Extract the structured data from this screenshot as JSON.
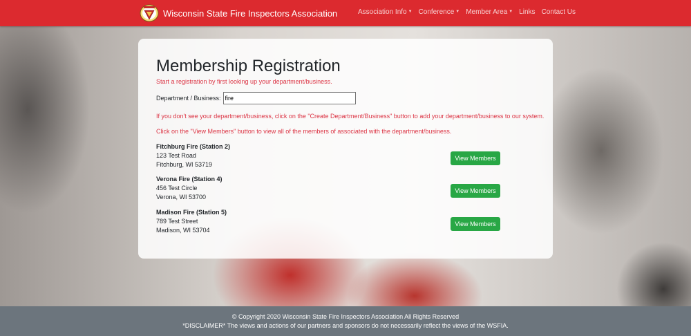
{
  "header": {
    "brand": "Wisconsin State Fire Inspectors Association",
    "nav": [
      {
        "label": "Association Info",
        "dropdown": true
      },
      {
        "label": "Conference",
        "dropdown": true
      },
      {
        "label": "Member Area",
        "dropdown": true
      },
      {
        "label": "Links",
        "dropdown": false
      },
      {
        "label": "Contact Us",
        "dropdown": false
      }
    ]
  },
  "main": {
    "title": "Membership Registration",
    "intro": "Start a registration by first looking up your department/business.",
    "lookup_label": "Department / Business:",
    "lookup_value": "fire",
    "note_create": "If you don't see your department/business, click on the \"Create Department/Business\" button to add your department/business to our system.",
    "note_view": "Click on the \"View Members\" button to view all of the members of associated with the department/business.",
    "departments": [
      {
        "name": "Fitchburg Fire (Station 2)",
        "street": "123 Test Road",
        "city": "Fitchburg, WI 53719",
        "button": "View Members"
      },
      {
        "name": "Verona Fire (Station 4)",
        "street": "456 Test Circle",
        "city": "Verona, WI 53700",
        "button": "View Members"
      },
      {
        "name": "Madison Fire (Station 5)",
        "street": "789 Test Street",
        "city": "Madison, WI 53704",
        "button": "View Members"
      }
    ]
  },
  "footer": {
    "copyright": "© Copyright 2020 Wisconsin State Fire Inspectors Association All Rights Reserved",
    "disclaimer": "*DISCLAIMER* The views and actions of our partners and sponsors do not necessarily reflect the views of the WSFIA."
  },
  "colors": {
    "navbar": "#dc2a2f",
    "accent_text": "#dc3545",
    "button": "#28a745",
    "footer": "#6c757d"
  }
}
